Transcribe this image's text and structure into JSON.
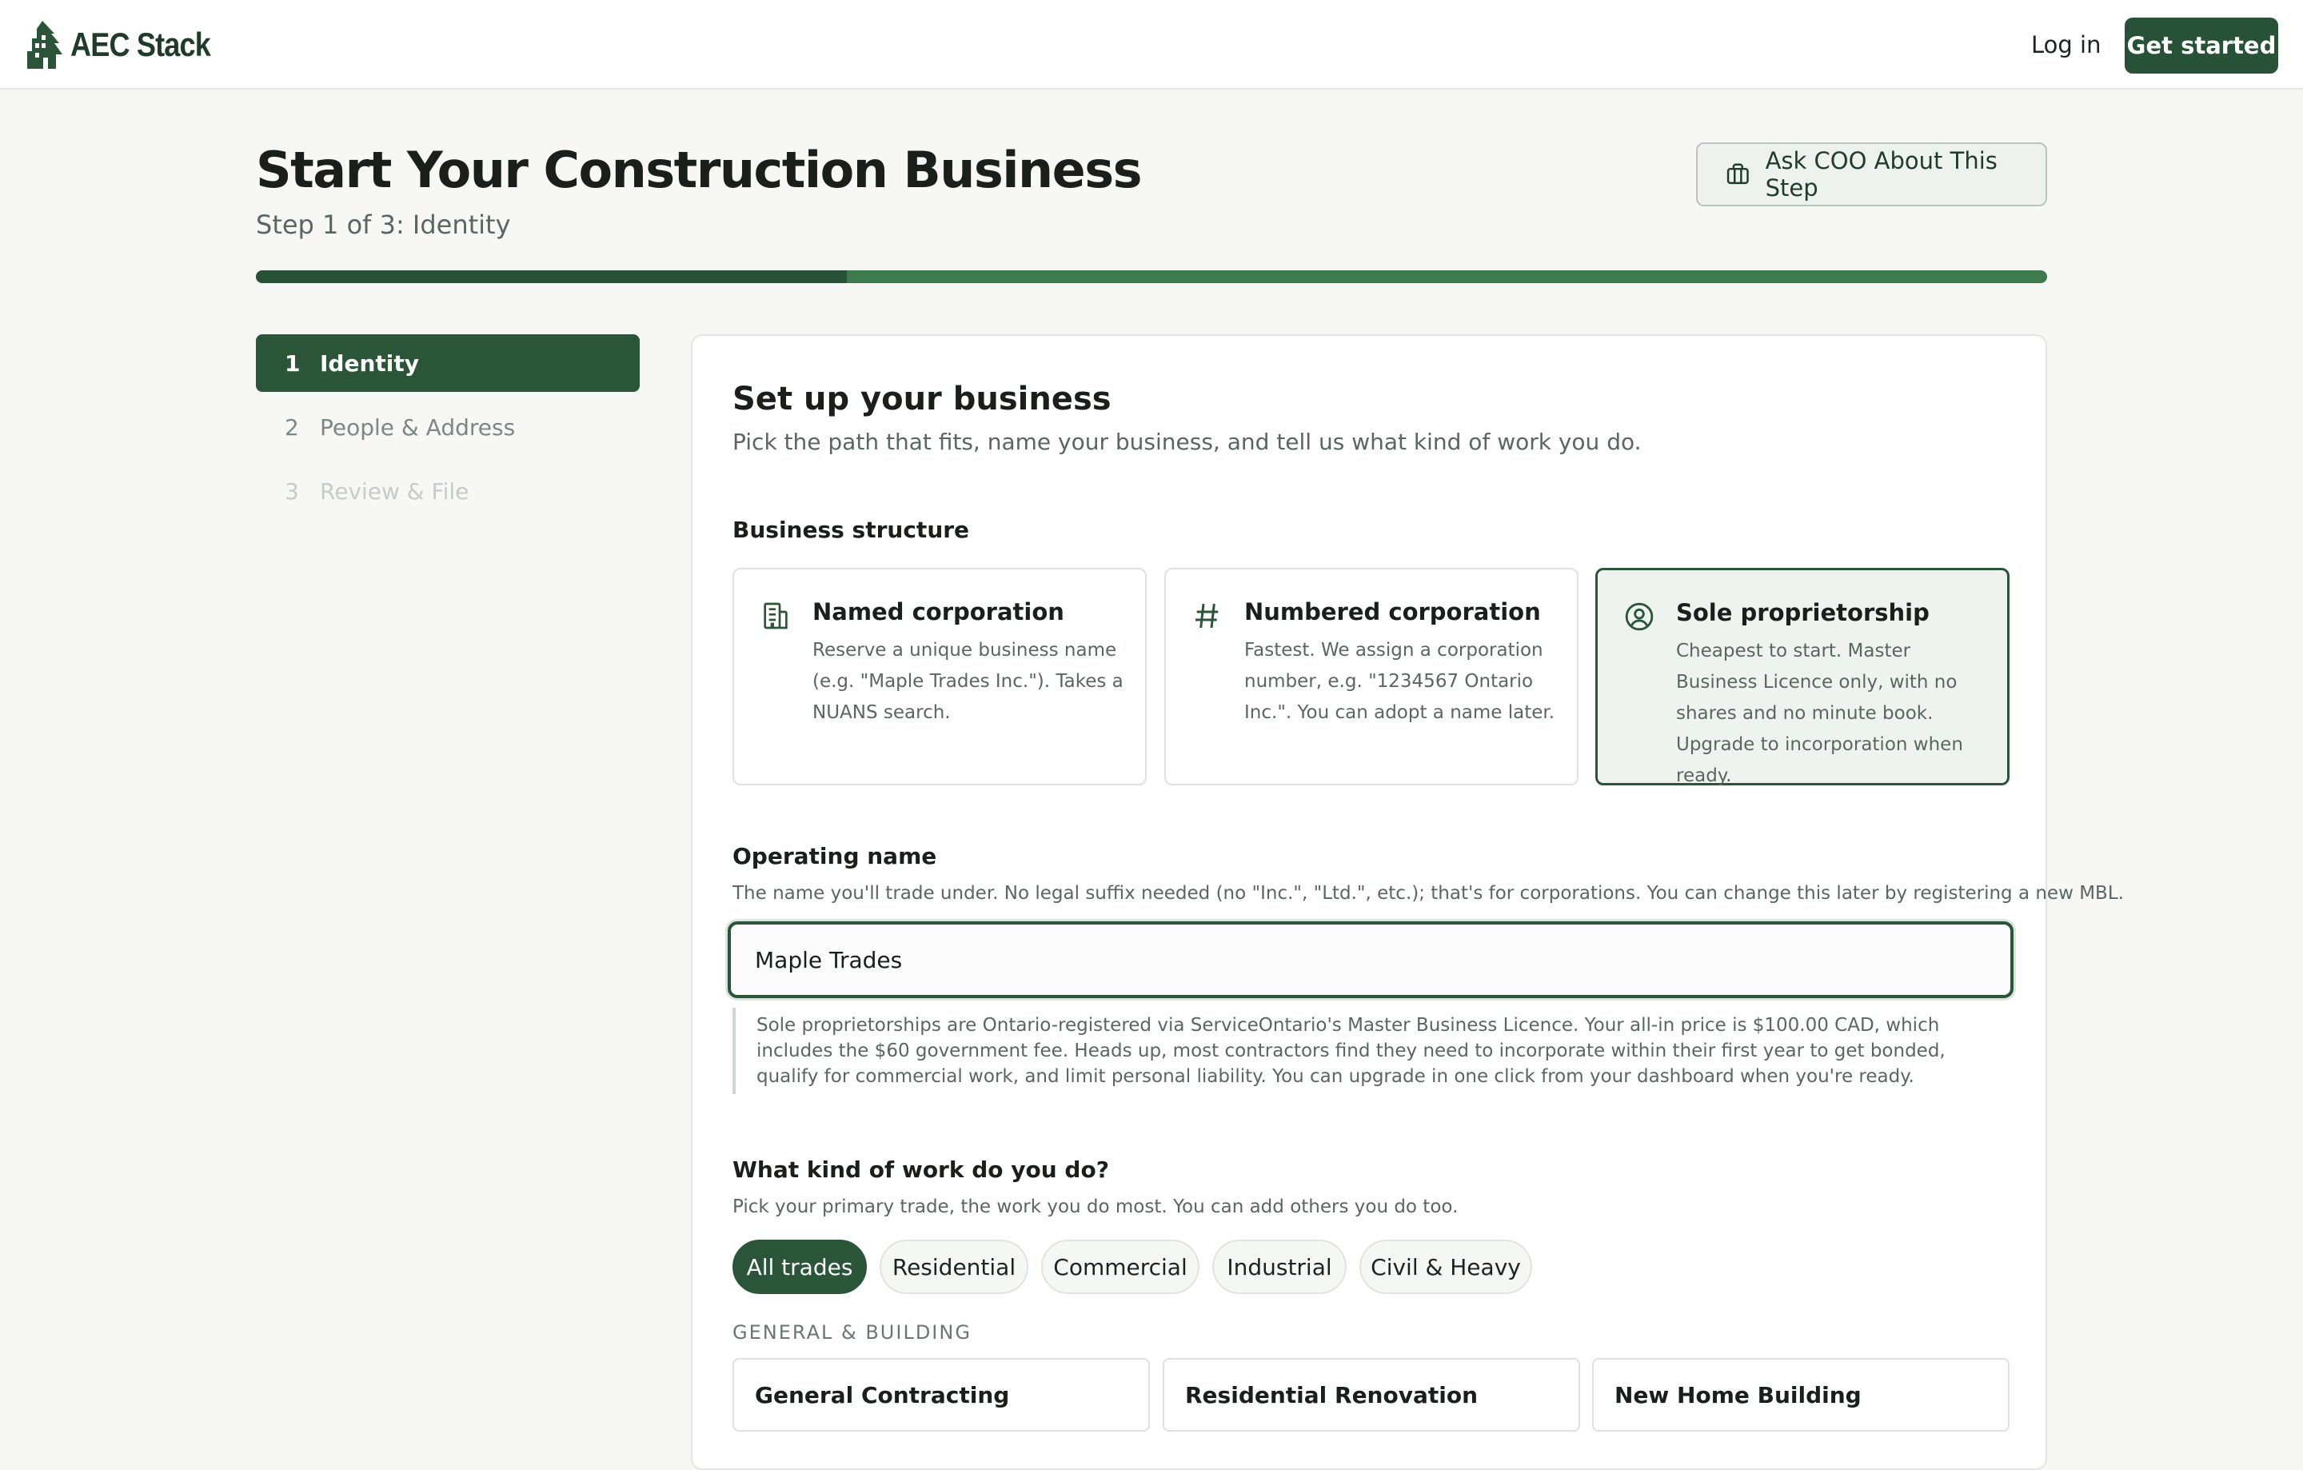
{
  "nav": {
    "logo_text": "AEC Stack",
    "login_label": "Log in",
    "get_started_label": "Get started"
  },
  "header": {
    "title": "Start Your Construction Business",
    "subtitle": "Step 1 of 3: Identity",
    "ask_label": "Ask COO About This Step",
    "progress_fraction": 0.33
  },
  "steps": [
    {
      "num": "1",
      "label": "Identity"
    },
    {
      "num": "2",
      "label": "People & Address"
    },
    {
      "num": "3",
      "label": "Review & File"
    }
  ],
  "card": {
    "title": "Set up your business",
    "subtitle": "Pick the path that fits, name your business, and tell us what kind of work you do.",
    "structure_label": "Business structure",
    "structures": [
      {
        "icon": "building-icon",
        "title": "Named corporation",
        "desc": "Reserve a unique business name (e.g. \"Maple Trades Inc.\"). Takes a NUANS search."
      },
      {
        "icon": "hash-icon",
        "title": "Numbered corporation",
        "desc": "Fastest. We assign a corporation number, e.g. \"1234567 Ontario Inc.\". You can adopt a name later."
      },
      {
        "icon": "user-circle-icon",
        "title": "Sole proprietorship",
        "desc": "Cheapest to start. Master Business Licence only, with no shares and no minute book. Upgrade to incorporation when ready."
      }
    ],
    "operating_name_label": "Operating name",
    "operating_name_help": "The name you'll trade under. No legal suffix needed (no \"Inc.\", \"Ltd.\", etc.); that's for corporations. You can change this later by registering a new MBL.",
    "operating_name_value": "Maple Trades",
    "note": "Sole proprietorships are Ontario-registered via ServiceOntario's Master Business Licence. Your all-in price is $100.00 CAD, which includes the $60 government fee. Heads up, most contractors find they need to incorporate within their first year to get bonded, qualify for commercial work, and limit personal liability. You can upgrade in one click from your dashboard when you're ready.",
    "work_label": "What kind of work do you do?",
    "work_help": "Pick your primary trade, the work you do most. You can add others you do too.",
    "chips": [
      "All trades",
      "Residential",
      "Commercial",
      "Industrial",
      "Civil & Heavy"
    ],
    "group_label": "GENERAL & BUILDING",
    "trades": [
      "General Contracting",
      "Residential Renovation",
      "New Home Building"
    ]
  },
  "colors": {
    "brand": "#285237",
    "progress_track": "#3d7a4c"
  }
}
